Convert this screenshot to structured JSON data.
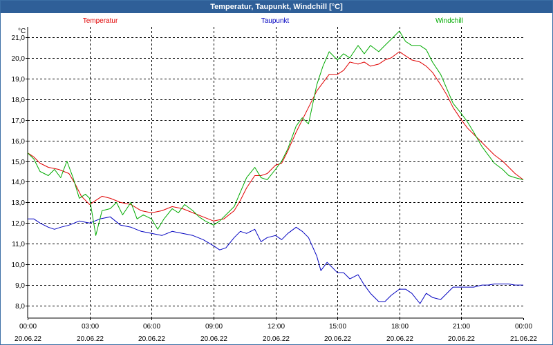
{
  "window": {
    "title": "Temperatur, Taupunkt, Windchill [°C]"
  },
  "chart_data": {
    "type": "line",
    "title": "Temperatur, Taupunkt, Windchill [°C]",
    "ylabel": "°C",
    "ylim": [
      7.4,
      21.5
    ],
    "yticks": [
      "8,0",
      "9,0",
      "10,0",
      "11,0",
      "12,0",
      "13,0",
      "14,0",
      "15,0",
      "16,0",
      "17,0",
      "18,0",
      "19,0",
      "20,0",
      "21,0"
    ],
    "xlim": [
      0,
      24
    ],
    "xticks": [
      {
        "time": "00:00",
        "date": "20.06.22"
      },
      {
        "time": "03:00",
        "date": "20.06.22"
      },
      {
        "time": "06:00",
        "date": "20.06.22"
      },
      {
        "time": "09:00",
        "date": "20.06.22"
      },
      {
        "time": "12:00",
        "date": "20.06.22"
      },
      {
        "time": "15:00",
        "date": "20.06.22"
      },
      {
        "time": "18:00",
        "date": "20.06.22"
      },
      {
        "time": "21:00",
        "date": "20.06.22"
      },
      {
        "time": "00:00",
        "date": "21.06.22"
      }
    ],
    "grid": true,
    "legend_position": "top",
    "series": [
      {
        "name": "Temperatur",
        "color": "#e00000",
        "x": [
          0,
          0.3,
          0.6,
          1,
          1.5,
          2,
          2.3,
          2.6,
          3,
          3.3,
          3.6,
          4,
          4.5,
          5,
          5.5,
          6,
          6.5,
          7,
          7.5,
          8,
          8.5,
          9,
          9.5,
          10,
          10.3,
          10.6,
          11,
          11.3,
          11.6,
          12,
          12.3,
          12.6,
          13,
          13.3,
          13.6,
          14,
          14.3,
          14.6,
          15,
          15.3,
          15.6,
          16,
          16.3,
          16.6,
          17,
          17.3,
          17.6,
          18,
          18.3,
          18.6,
          19,
          19.3,
          19.6,
          20,
          20.3,
          20.6,
          21,
          21.3,
          21.6,
          22,
          22.3,
          22.6,
          23,
          23.3,
          23.6,
          24
        ],
        "values": [
          15.4,
          15.2,
          14.9,
          14.7,
          14.6,
          14.4,
          13.9,
          13.3,
          12.9,
          13.1,
          13.3,
          13.2,
          13.0,
          12.9,
          12.6,
          12.5,
          12.6,
          12.8,
          12.7,
          12.5,
          12.3,
          12.1,
          12.2,
          12.6,
          13.1,
          13.7,
          14.3,
          14.3,
          14.4,
          14.8,
          14.9,
          15.5,
          16.4,
          17.0,
          17.6,
          18.4,
          18.8,
          19.2,
          19.2,
          19.4,
          19.8,
          19.7,
          19.8,
          19.6,
          19.7,
          19.9,
          20.0,
          20.3,
          20.1,
          19.9,
          19.8,
          19.6,
          19.3,
          18.7,
          18.2,
          17.6,
          17.0,
          16.6,
          16.3,
          15.9,
          15.6,
          15.3,
          15.0,
          14.7,
          14.4,
          14.1
        ]
      },
      {
        "name": "Taupunkt",
        "color": "#0000c0",
        "x": [
          0,
          0.3,
          0.6,
          1,
          1.3,
          1.6,
          2,
          2.5,
          3,
          3.5,
          4,
          4.5,
          5,
          5.5,
          6,
          6.5,
          7,
          7.5,
          8,
          8.5,
          9,
          9.3,
          9.6,
          10,
          10.3,
          10.6,
          11,
          11.3,
          11.6,
          12,
          12.3,
          12.6,
          13,
          13.3,
          13.6,
          14,
          14.2,
          14.5,
          14.8,
          15,
          15.3,
          15.6,
          16,
          16.3,
          16.6,
          17,
          17.3,
          17.6,
          18,
          18.3,
          18.6,
          19,
          19.3,
          19.6,
          20,
          20.3,
          20.6,
          21,
          21.3,
          21.6,
          22,
          22.3,
          22.6,
          23,
          23.3,
          23.6,
          24
        ],
        "values": [
          12.2,
          12.2,
          12.0,
          11.8,
          11.7,
          11.8,
          11.9,
          12.1,
          12.0,
          12.2,
          12.3,
          11.9,
          11.8,
          11.6,
          11.5,
          11.4,
          11.6,
          11.5,
          11.4,
          11.2,
          10.9,
          10.7,
          10.8,
          11.3,
          11.6,
          11.5,
          11.7,
          11.1,
          11.3,
          11.4,
          11.2,
          11.5,
          11.8,
          11.6,
          11.3,
          10.4,
          9.7,
          10.1,
          9.8,
          9.6,
          9.6,
          9.3,
          9.5,
          9.0,
          8.6,
          8.2,
          8.2,
          8.5,
          8.8,
          8.8,
          8.6,
          8.1,
          8.6,
          8.4,
          8.3,
          8.6,
          8.9,
          8.9,
          8.9,
          8.9,
          9.0,
          9.0,
          9.05,
          9.05,
          9.05,
          9.0,
          9.0
        ]
      },
      {
        "name": "Windchill",
        "color": "#00aa00",
        "x": [
          0,
          0.3,
          0.6,
          1,
          1.3,
          1.6,
          1.9,
          2.2,
          2.5,
          2.8,
          3,
          3.3,
          3.6,
          4,
          4.3,
          4.6,
          5,
          5.3,
          5.6,
          6,
          6.3,
          6.6,
          7,
          7.3,
          7.6,
          8,
          8.3,
          8.6,
          9,
          9.3,
          9.6,
          10,
          10.3,
          10.6,
          11,
          11.3,
          11.6,
          12,
          12.3,
          12.6,
          13,
          13.3,
          13.6,
          14,
          14.3,
          14.6,
          15,
          15.3,
          15.6,
          16,
          16.3,
          16.6,
          17,
          17.3,
          17.6,
          18,
          18.3,
          18.6,
          19,
          19.3,
          19.6,
          20,
          20.3,
          20.6,
          21,
          21.3,
          21.6,
          22,
          22.3,
          22.6,
          23,
          23.3,
          23.6,
          24
        ],
        "values": [
          15.4,
          15.1,
          14.5,
          14.3,
          14.6,
          14.2,
          15.0,
          14.2,
          13.2,
          13.4,
          13.2,
          11.4,
          12.6,
          12.7,
          13.0,
          12.4,
          13.0,
          12.2,
          12.4,
          12.2,
          11.7,
          12.2,
          12.7,
          12.5,
          12.9,
          12.6,
          12.3,
          12.1,
          11.9,
          12.1,
          12.4,
          12.8,
          13.5,
          14.2,
          14.7,
          14.2,
          14.1,
          14.6,
          15.0,
          15.6,
          16.7,
          17.1,
          16.8,
          18.7,
          19.6,
          20.3,
          19.9,
          20.2,
          20.0,
          20.6,
          20.2,
          20.6,
          20.3,
          20.6,
          20.9,
          21.3,
          20.8,
          20.6,
          20.6,
          20.4,
          19.8,
          19.2,
          18.5,
          17.8,
          17.3,
          16.9,
          16.4,
          15.7,
          15.3,
          14.9,
          14.6,
          14.3,
          14.2,
          14.1
        ]
      }
    ]
  }
}
